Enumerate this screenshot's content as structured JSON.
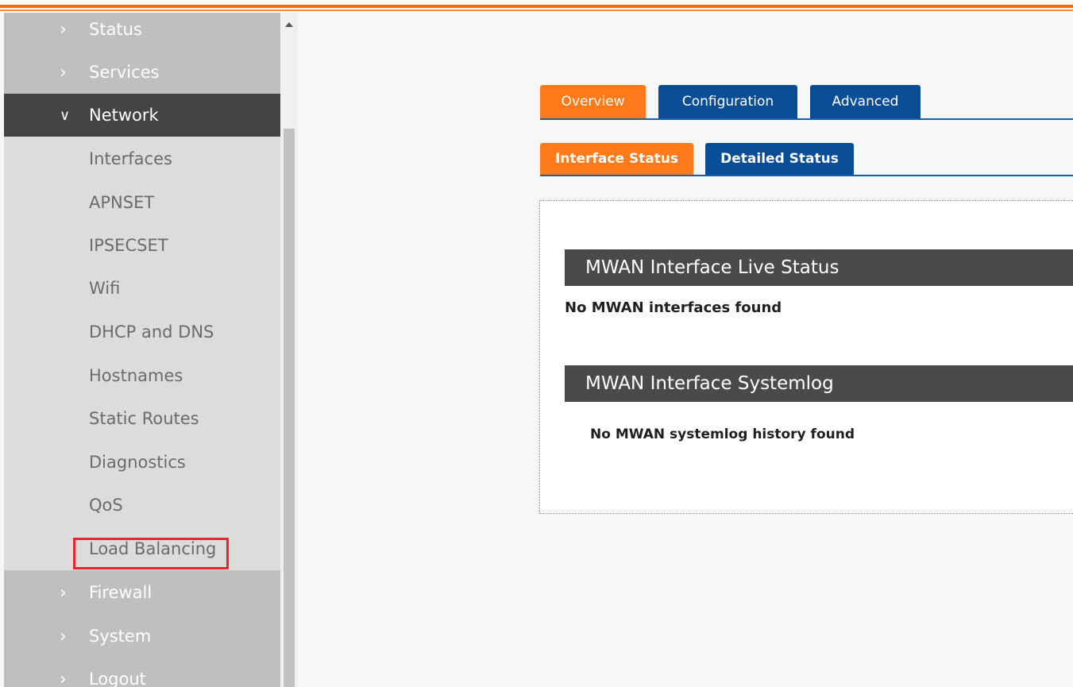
{
  "sidebar": {
    "top_items": [
      {
        "label": "Status"
      },
      {
        "label": "Services"
      }
    ],
    "active_item": {
      "label": "Network"
    },
    "sub_items": [
      {
        "label": "Interfaces"
      },
      {
        "label": "APNSET"
      },
      {
        "label": "IPSECSET"
      },
      {
        "label": "Wifi"
      },
      {
        "label": "DHCP and DNS"
      },
      {
        "label": "Hostnames"
      },
      {
        "label": "Static Routes"
      },
      {
        "label": "Diagnostics"
      },
      {
        "label": "QoS"
      },
      {
        "label": "Load Balancing"
      }
    ],
    "bottom_items": [
      {
        "label": "Firewall"
      },
      {
        "label": "System"
      },
      {
        "label": "Logout"
      }
    ]
  },
  "tabs": [
    {
      "label": "Overview",
      "state": "active"
    },
    {
      "label": "Configuration",
      "state": "inactive"
    },
    {
      "label": "Advanced",
      "state": "inactive"
    }
  ],
  "subtabs": [
    {
      "label": "Interface Status",
      "state": "active"
    },
    {
      "label": "Detailed Status",
      "state": "inactive"
    }
  ],
  "main": {
    "live_status": {
      "title": "MWAN Interface Live Status",
      "message": "No MWAN interfaces found"
    },
    "systemlog": {
      "title": "MWAN Interface Systemlog",
      "message": "No MWAN systemlog history found"
    }
  },
  "colors": {
    "accent_orange": "#ff7a1a",
    "tab_blue": "#0a4d97",
    "highlight_red": "#e8252c"
  },
  "icons": {
    "collapsed": "chevron-right-icon",
    "expanded": "chevron-down-icon"
  }
}
